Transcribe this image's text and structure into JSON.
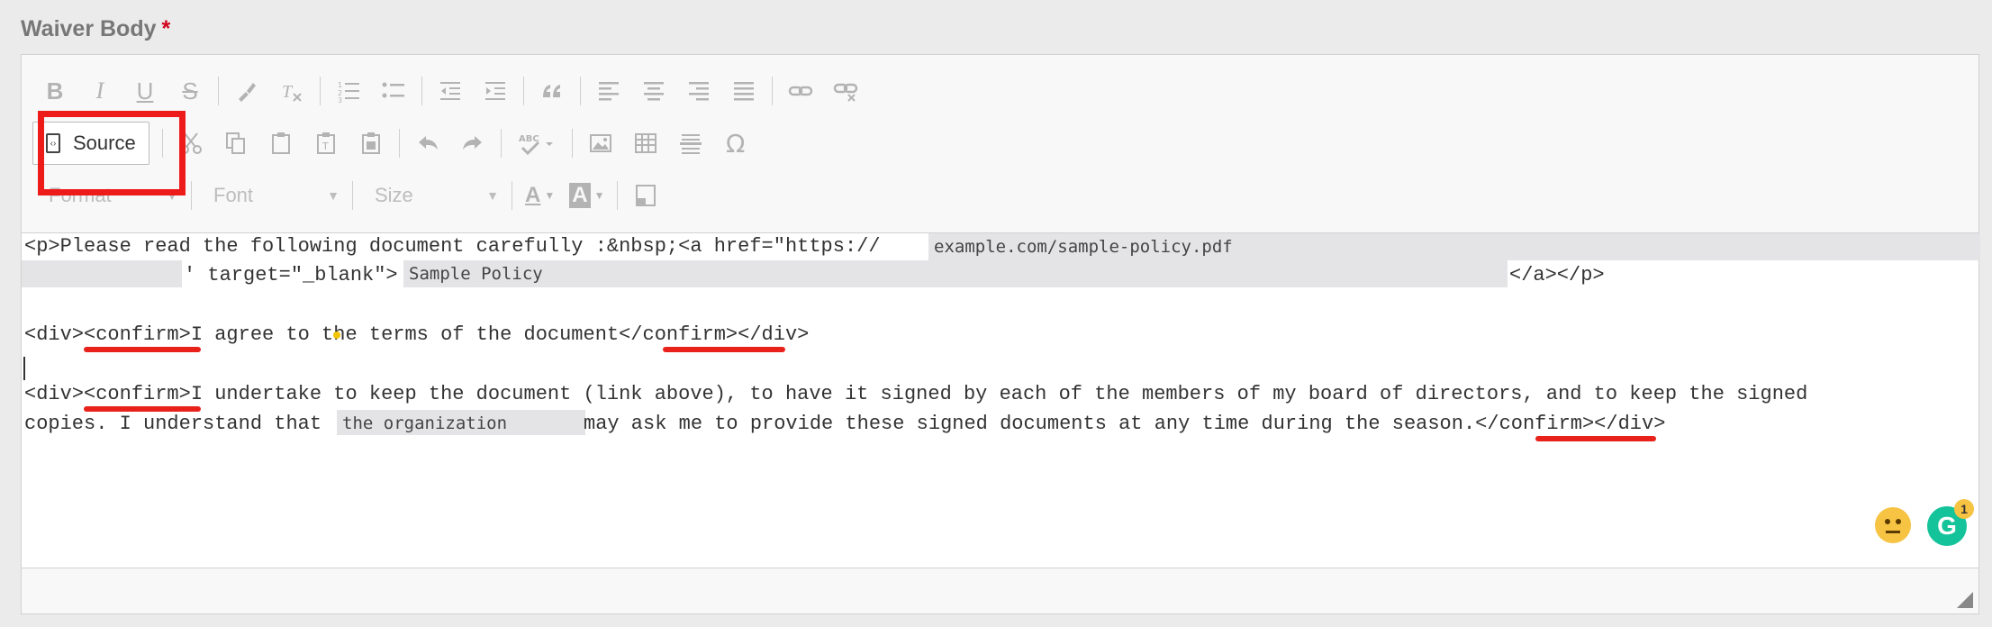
{
  "field": {
    "label": "Waiver Body",
    "required_mark": "*"
  },
  "toolbar": {
    "row1": [
      {
        "name": "bold-button",
        "glyph": "B"
      },
      {
        "name": "italic-button",
        "glyph": "I"
      },
      {
        "name": "underline-button",
        "glyph": "U"
      },
      {
        "name": "strike-button",
        "glyph": "S"
      },
      {
        "name": "copy-format-button",
        "glyph": "🖌"
      },
      {
        "name": "remove-format-button",
        "glyph": "Tx"
      },
      {
        "name": "numbered-list-button",
        "glyph": "☰"
      },
      {
        "name": "bulleted-list-button",
        "glyph": "☷"
      },
      {
        "name": "outdent-button",
        "glyph": "⇤"
      },
      {
        "name": "indent-button",
        "glyph": "⇥"
      },
      {
        "name": "blockquote-button",
        "glyph": "❞"
      },
      {
        "name": "align-left-button",
        "glyph": "≡"
      },
      {
        "name": "align-center-button",
        "glyph": "≡"
      },
      {
        "name": "align-right-button",
        "glyph": "≡"
      },
      {
        "name": "justify-button",
        "glyph": "≣"
      },
      {
        "name": "link-button",
        "glyph": "⛓"
      },
      {
        "name": "unlink-button",
        "glyph": "⛓"
      }
    ],
    "source_label": "Source",
    "row2": [
      {
        "name": "cut-button",
        "glyph": "✂"
      },
      {
        "name": "copy-button",
        "glyph": "⎘"
      },
      {
        "name": "paste-button",
        "glyph": "📋"
      },
      {
        "name": "paste-text-button",
        "glyph": "📋"
      },
      {
        "name": "paste-word-button",
        "glyph": "📋"
      },
      {
        "name": "undo-button",
        "glyph": "↶"
      },
      {
        "name": "redo-button",
        "glyph": "↷"
      },
      {
        "name": "spellcheck-button",
        "glyph": "✓"
      },
      {
        "name": "image-button",
        "glyph": "🖼"
      },
      {
        "name": "table-button",
        "glyph": "▦"
      },
      {
        "name": "horizontal-line-button",
        "glyph": "☰"
      },
      {
        "name": "special-char-button",
        "glyph": "Ω"
      }
    ],
    "format_label": "Format",
    "font_label": "Font",
    "size_label": "Size",
    "text_color_glyph": "A",
    "bg_color_glyph": "A"
  },
  "content": {
    "line1_prefix": "<p>Please read the following document carefully :&nbsp;<a href=\"https://",
    "line1_url": "example.com/sample-policy.pdf",
    "line2_mid": "' target=\"_blank\">",
    "line2_linktext": "Sample Policy",
    "line2_end": "</a></p>",
    "line3": "<div><confirm>I agree to the terms of the document</confirm></div>",
    "line4a": "<div><confirm>I undertake to keep the document (link above), to have it signed by each of the members of my board of directors, and to keep the signed",
    "line4b_prefix": "copies. I understand that",
    "line4b_org": "the organization",
    "line4b_suffix": "may ask me to provide these signed documents at any time during the season.</confirm></div>"
  },
  "grammarly": {
    "badge": "1",
    "glyph": "G"
  }
}
